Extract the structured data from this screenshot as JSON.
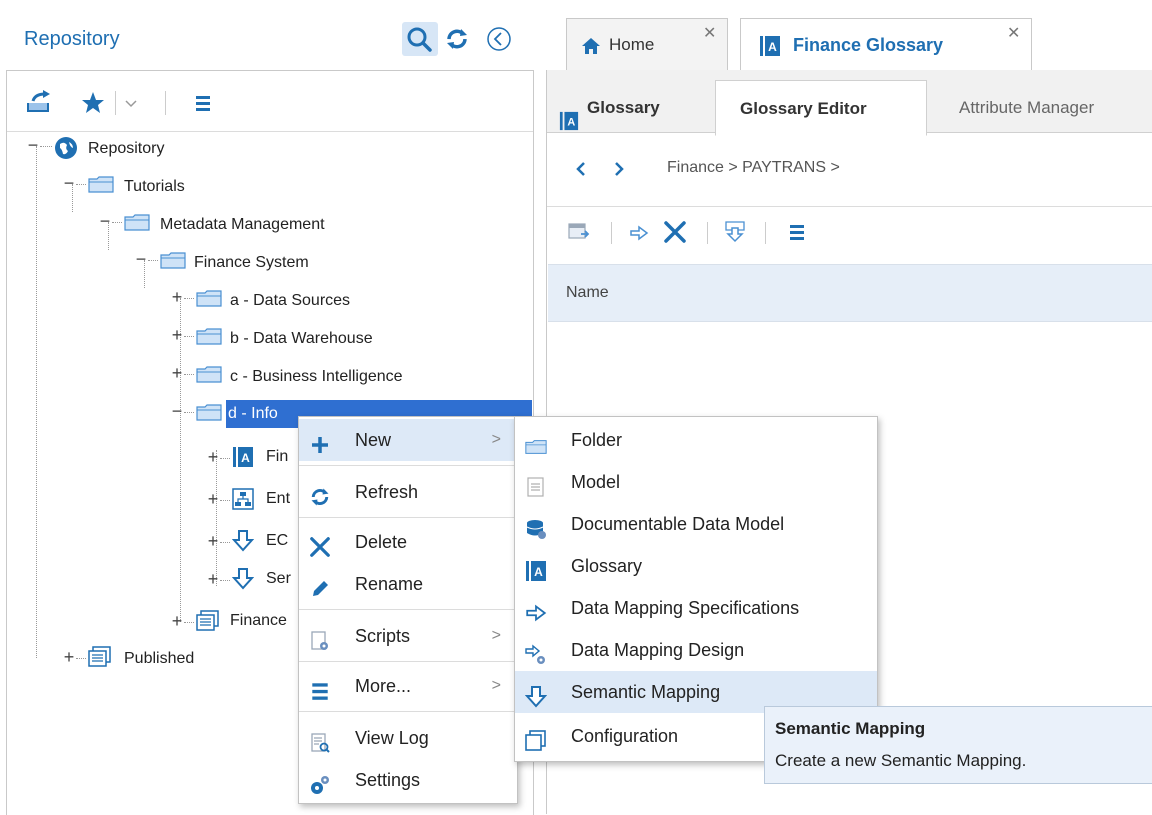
{
  "left": {
    "title": "Repository",
    "tree": [
      {
        "label": "Repository"
      },
      {
        "label": "Tutorials"
      },
      {
        "label": "Metadata Management"
      },
      {
        "label": "Finance System"
      },
      {
        "label": "a - Data Sources"
      },
      {
        "label": "b - Data Warehouse"
      },
      {
        "label": "c - Business Intelligence"
      },
      {
        "label": "d - Info"
      },
      {
        "label": "Fin"
      },
      {
        "label": "Ent"
      },
      {
        "label": "EC"
      },
      {
        "label": "Ser"
      },
      {
        "label": "Finance"
      },
      {
        "label": "Published"
      }
    ]
  },
  "tabs": {
    "home": "Home",
    "finance_glossary": "Finance Glossary"
  },
  "subtabs": {
    "glossary": "Glossary",
    "glossary_editor": "Glossary Editor",
    "attribute_manager": "Attribute Manager"
  },
  "breadcrumb": "Finance > PAYTRANS >",
  "table": {
    "name_header": "Name"
  },
  "context_menu": [
    {
      "label": "New"
    },
    {
      "label": "Refresh"
    },
    {
      "label": "Delete"
    },
    {
      "label": "Rename"
    },
    {
      "label": "Scripts"
    },
    {
      "label": "More..."
    },
    {
      "label": "View Log"
    },
    {
      "label": "Settings"
    }
  ],
  "submenu": [
    {
      "label": "Folder"
    },
    {
      "label": "Model"
    },
    {
      "label": "Documentable Data Model"
    },
    {
      "label": "Glossary"
    },
    {
      "label": "Data Mapping Specifications"
    },
    {
      "label": "Data Mapping Design"
    },
    {
      "label": "Semantic Mapping"
    },
    {
      "label": "Configuration"
    }
  ],
  "tooltip": {
    "title": "Semantic Mapping",
    "text": "Create a new Semantic Mapping."
  },
  "colors": {
    "accent": "#1f6fb2",
    "selection": "#2f6fd1",
    "hover": "#dde9f7"
  }
}
